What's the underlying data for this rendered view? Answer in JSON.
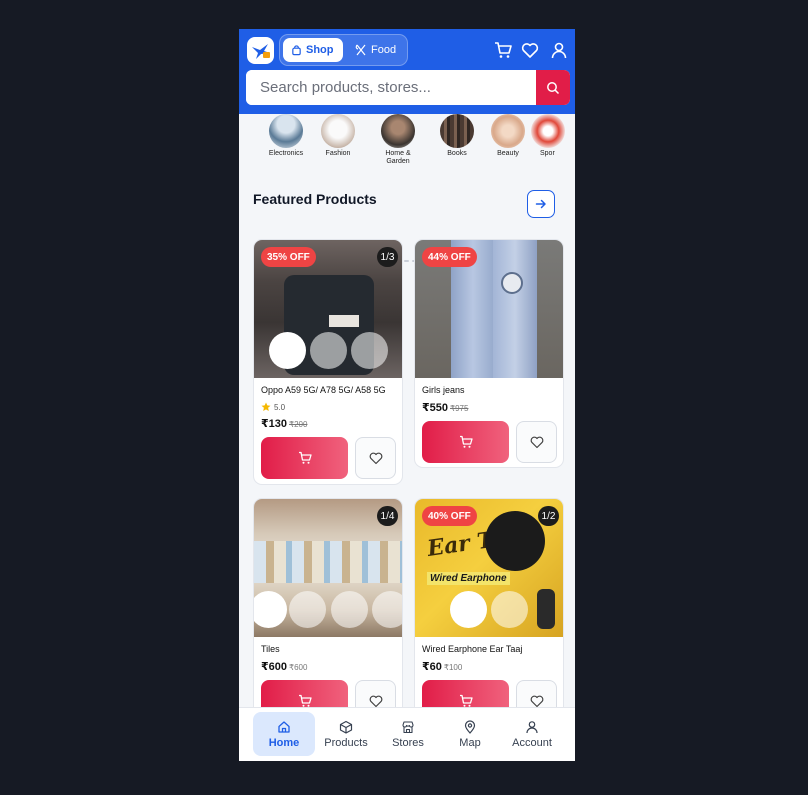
{
  "header": {
    "logo_icon": "bird-logo-icon",
    "modes": [
      {
        "label": "Shop",
        "icon": "bag-icon",
        "active": true
      },
      {
        "label": "Food",
        "icon": "utensils-icon",
        "active": false
      }
    ],
    "icons": [
      "cart-icon",
      "heart-icon",
      "user-icon"
    ],
    "accent": "#1f5ee6"
  },
  "search": {
    "placeholder": "Search products, stores...",
    "button_icon": "search-icon",
    "button_color": "#e11d48"
  },
  "categories": [
    {
      "label": "Electronics"
    },
    {
      "label": "Fashion"
    },
    {
      "label": "Home & Garden"
    },
    {
      "label": "Books"
    },
    {
      "label": "Beauty"
    },
    {
      "label": "Spor"
    }
  ],
  "featured": {
    "title": "Featured Products",
    "see_all_icon": "arrow-right-icon"
  },
  "products": [
    {
      "name": "Oppo A59 5G/ A78 5G/ A58 5G",
      "discount": "35% OFF",
      "counter": "1/3",
      "rating": "5.0",
      "price": "₹130",
      "old_price": "₹200"
    },
    {
      "name": "Girls jeans",
      "discount": "44% OFF",
      "counter": "",
      "rating": "",
      "price": "₹550",
      "old_price": "₹975"
    },
    {
      "name": "Tiles",
      "discount": "",
      "counter": "1/4",
      "rating": "",
      "price": "₹600",
      "old_price": "₹600"
    },
    {
      "name": "Wired Earphone Ear Taaj",
      "discount": "40% OFF",
      "counter": "1/2",
      "rating": "",
      "price": "₹60",
      "old_price": "₹100"
    }
  ],
  "product_image_text": {
    "earphone_brand": "Ear Taaj",
    "earphone_sub": "Wired Earphone"
  },
  "nav": [
    {
      "label": "Home",
      "icon": "home-icon",
      "active": true
    },
    {
      "label": "Products",
      "icon": "box-icon",
      "active": false
    },
    {
      "label": "Stores",
      "icon": "store-icon",
      "active": false
    },
    {
      "label": "Map",
      "icon": "map-pin-icon",
      "active": false
    },
    {
      "label": "Account",
      "icon": "user-icon",
      "active": false
    }
  ]
}
